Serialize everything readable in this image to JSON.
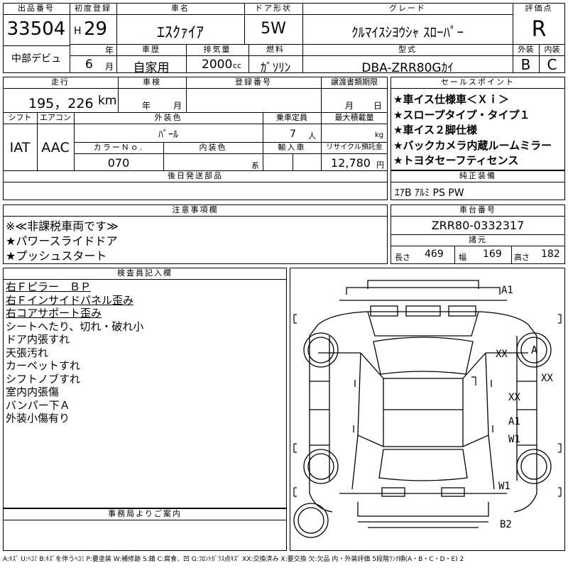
{
  "header": {
    "lot_label": "出品番号",
    "lot_no": "33504",
    "auction": "中部デビュ",
    "first_reg_label": "初度登録",
    "era": "H",
    "year": "29",
    "year_unit": "年",
    "month": "6",
    "month_unit": "月",
    "car_name_label": "車名",
    "car_name": "ｴｽｸｧｲｱ",
    "history_label": "車歴",
    "history": "自家用",
    "displacement_label": "排気量",
    "displacement": "2000",
    "displacement_unit": "cc",
    "door_label": "ドア形状",
    "door": "5W",
    "fuel_label": "燃料",
    "fuel": "ｶﾞｿﾘﾝ",
    "grade_label": "グレード",
    "grade": "ｸﾙﾏｲｽｼﾖｳｼｬ ｽﾛｰﾊﾟｰ",
    "model_label": "型式",
    "model": "DBA-ZRR80Gｶｲ",
    "score_label": "評価点",
    "score": "R",
    "ext_label": "外装",
    "ext": "B",
    "int_label": "内装",
    "int": "C"
  },
  "details": {
    "mileage_label": "走行",
    "mileage": "195，226",
    "mileage_unit": "km",
    "inspection_label": "車検",
    "insp_year_unit": "年",
    "insp_month_unit": "月",
    "plate_label": "登録番号",
    "transfer_label": "譲渡書類期限",
    "transfer_month_unit": "月",
    "transfer_day_unit": "日",
    "shift_label": "シフト",
    "shift": "IAT",
    "ac_label": "エアコン",
    "ac": "AAC",
    "color_label": "外装色",
    "color": "ﾊﾟｰﾙ",
    "capacity_label": "乗車定員",
    "capacity": "7",
    "capacity_unit": "人",
    "load_label": "最大積載量",
    "load_unit": "kg",
    "color_no_label": "カラーＮｏ.",
    "color_no": "070",
    "int_color_label": "内装色",
    "int_color_unit": "系",
    "import_label": "輸入車",
    "recycle_label": "リサイクル預託金",
    "recycle": "12,780",
    "recycle_unit": "円",
    "later_label": "後日発送部品"
  },
  "sales": {
    "label": "セールスポイント",
    "points": [
      "★車イス仕様車＜Ｘｉ＞",
      "★スロープタイプ・タイプ１",
      "★車イス２脚仕様",
      "★バックカメラ内蔵ルームミラー",
      "★トヨタセーフティセンス"
    ]
  },
  "equipment": {
    "label": "純正装備",
    "text": "ｴｱB ｱﾙﾐ PS PW"
  },
  "notes": {
    "label": "注意事項欄",
    "lines": [
      "※≪非課税車両です≫",
      "★パワースライドドア",
      "★プッシュスタート"
    ]
  },
  "chassis": {
    "label": "車台番号",
    "number": "ZRR80-0332317",
    "dims_label": "諸元",
    "length_label": "長さ",
    "length": "469",
    "width_label": "幅",
    "width": "169",
    "height_label": "高さ",
    "height": "182"
  },
  "inspector": {
    "label": "検査員記入欄",
    "lines": [
      {
        "text": "右Ｆピラー＿ＢＰ",
        "underline": true
      },
      {
        "text": "右Ｆインサイドパネル歪み",
        "underline": true
      },
      {
        "text": "右コアサポート歪み",
        "underline": true
      },
      {
        "text": "シートへたり、切れ・破れ小",
        "underline": false
      },
      {
        "text": "ドア内張すれ",
        "underline": false
      },
      {
        "text": "天張汚れ",
        "underline": false
      },
      {
        "text": "カーペットすれ",
        "underline": false
      },
      {
        "text": "シフトノブすれ",
        "underline": false
      },
      {
        "text": "室内内張傷",
        "underline": false
      },
      {
        "text": "バンパー下Ａ",
        "underline": false
      },
      {
        "text": "外装小傷有り",
        "underline": false
      }
    ]
  },
  "office": {
    "label": "事務局よりご案内"
  },
  "diagram": {
    "marks": {
      "a1_top": "A1",
      "xx_left": "XX",
      "a_circle": "A",
      "xx_right": "XX",
      "xx_mid": "XX",
      "a1_mid": "A1",
      "w1_mid": "W1",
      "w1_low": "W1",
      "b2": "B2"
    }
  },
  "footer": {
    "legend": "A:ｷｽﾞ U:ﾍｺﾐ B:ｷｽﾞを伴うﾍｺﾐ P:要塗装 W:補修跡 S:錆 C:腐食、凹 G:ﾌﾛﾝﾄｶﾞﾗｽ点ｷｽﾞ XX:交換済み X:要交換 欠:欠品 内・外装評価 5段階ﾗﾝｸ順(A・B・C・D・E) 2"
  }
}
